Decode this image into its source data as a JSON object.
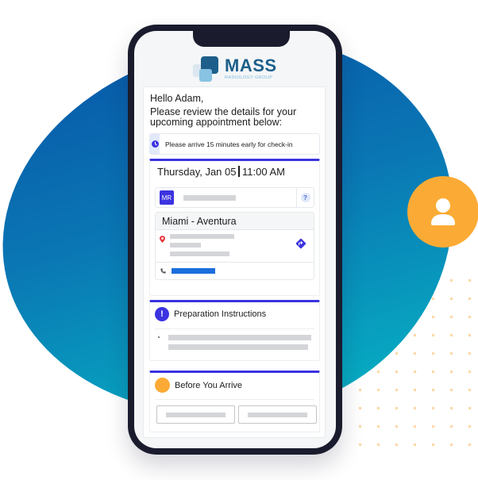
{
  "brand": {
    "name": "MASS",
    "tagline": "RADIOLOGY GROUP",
    "colors": {
      "primary": "#1d5f8a",
      "accent": "#3b33e0",
      "orange": "#fbab35",
      "link": "#1b6fdc"
    }
  },
  "email": {
    "greeting": "Hello Adam,",
    "intro": "Please review the details for your upcoming appointment below:",
    "notice": {
      "icon": "clock-icon",
      "text": "Please arrive 15 minutes early for check-in"
    }
  },
  "appointment": {
    "day": "Thursday, Jan 05",
    "time": "11:00 AM",
    "provider": {
      "initials": "MR",
      "help_label": "?"
    },
    "location": {
      "name": "Miami - Aventura",
      "pin_icon": "map-pin-icon",
      "directions_icon": "directions-icon",
      "phone_icon": "phone-icon"
    }
  },
  "preparation": {
    "icon": "exclamation-icon",
    "icon_label": "!",
    "title": "Preparation Instructions"
  },
  "before_arrive": {
    "title": "Before You Arrive"
  },
  "decor": {
    "user_badge_icon": "user-icon"
  }
}
